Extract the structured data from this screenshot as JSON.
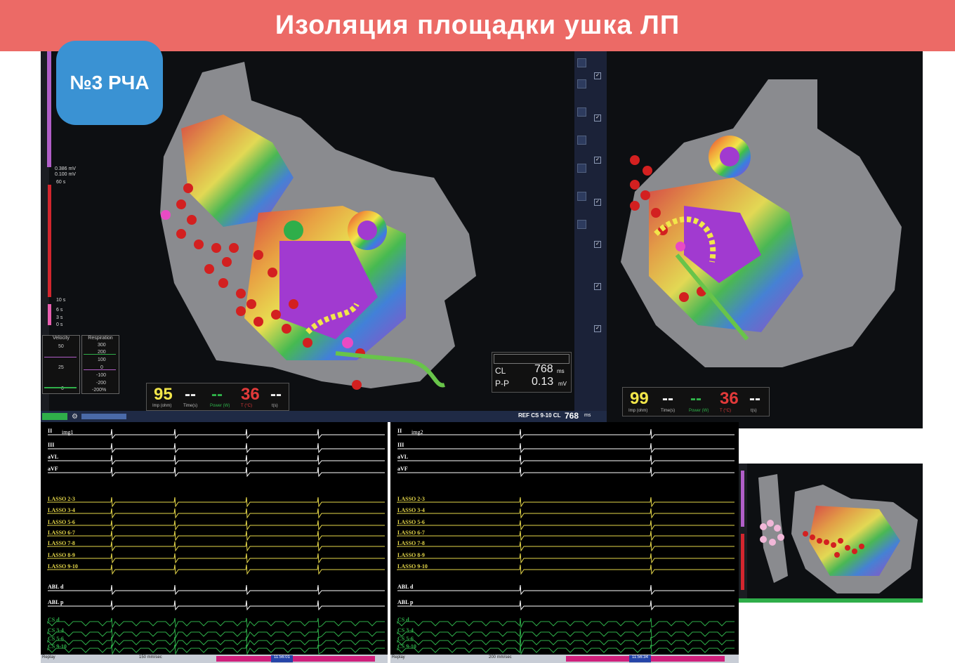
{
  "banner": {
    "title": "Изоляция площадки ушка ЛП"
  },
  "badge": {
    "label": "№3 РЧА"
  },
  "main_view": {
    "thresholds": {
      "upper": "0.386 mV",
      "lower": "0.100 mV",
      "time": "60 s"
    },
    "time_marks": [
      "10 s",
      "6 s",
      "3 s",
      "0 s"
    ],
    "velocity": {
      "title": "Velocity",
      "values": [
        "50",
        "25",
        "0"
      ]
    },
    "respiration": {
      "title": "Respiration",
      "values": [
        "300",
        "200",
        "100",
        "0",
        "-100",
        "-200",
        "-200%"
      ]
    },
    "ablation": {
      "imp": "95",
      "imp_label": "Imp (ohm)",
      "time": "--",
      "time_label": "Time(s)",
      "power": "--",
      "power_label": "Power (W)",
      "temp": "36",
      "temp_label": "T (°C)",
      "last": "--",
      "last_label": "t(s)"
    },
    "cl_panel": {
      "cl_label": "CL",
      "cl_value": "768",
      "cl_unit": "ms",
      "pp_label": "P-P",
      "pp_value": "0.13",
      "pp_unit": "mV"
    },
    "ref": {
      "label": "REF CS  9-10 CL",
      "value": "768",
      "unit": "ms"
    }
  },
  "right_view": {
    "ablation": {
      "imp": "99",
      "imp_label": "Imp (ohm)",
      "time": "--",
      "time_label": "Time(s)",
      "power": "--",
      "power_label": "Power (W)",
      "temp": "36",
      "temp_label": "T (°C)",
      "last": "--",
      "last_label": "t(s)"
    }
  },
  "ecg_left": {
    "marker": "img1",
    "channels": [
      "II",
      "III",
      "aVL",
      "aVF",
      "LASSO 2-3",
      "LASSO 3-4",
      "LASSO 5-6",
      "LASSO 6-7",
      "LASSO 7-8",
      "LASSO 8-9",
      "LASSO 9-10",
      "ABL d",
      "ABL p",
      "CS d",
      "CS 3-4",
      "CS 5-6",
      "CS 9-10"
    ],
    "status": {
      "mode": "Replay",
      "speed": "150 mm/sec",
      "time": "11:56:01"
    }
  },
  "ecg_right": {
    "marker": "img2",
    "channels": [
      "II",
      "III",
      "aVL",
      "aVF",
      "LASSO 2-3",
      "LASSO 3-4",
      "LASSO 5-6",
      "LASSO 6-7",
      "LASSO 7-8",
      "LASSO 8-9",
      "LASSO 9-10",
      "ABL d",
      "ABL p",
      "CS d",
      "CS 3-4",
      "CS 5-6",
      "CS 9-10"
    ],
    "status": {
      "mode": "Replay",
      "speed": "200 mm/sec",
      "time": "11:56:34"
    }
  },
  "colors": {
    "banner": "#ec6a66",
    "badge": "#3a92d3",
    "lasso": "#e6d84a",
    "surface": "#ffffff",
    "cs": "#2fae4a",
    "imp": "#f2e64a",
    "temp": "#e23a3a",
    "power": "#2fb34a"
  }
}
